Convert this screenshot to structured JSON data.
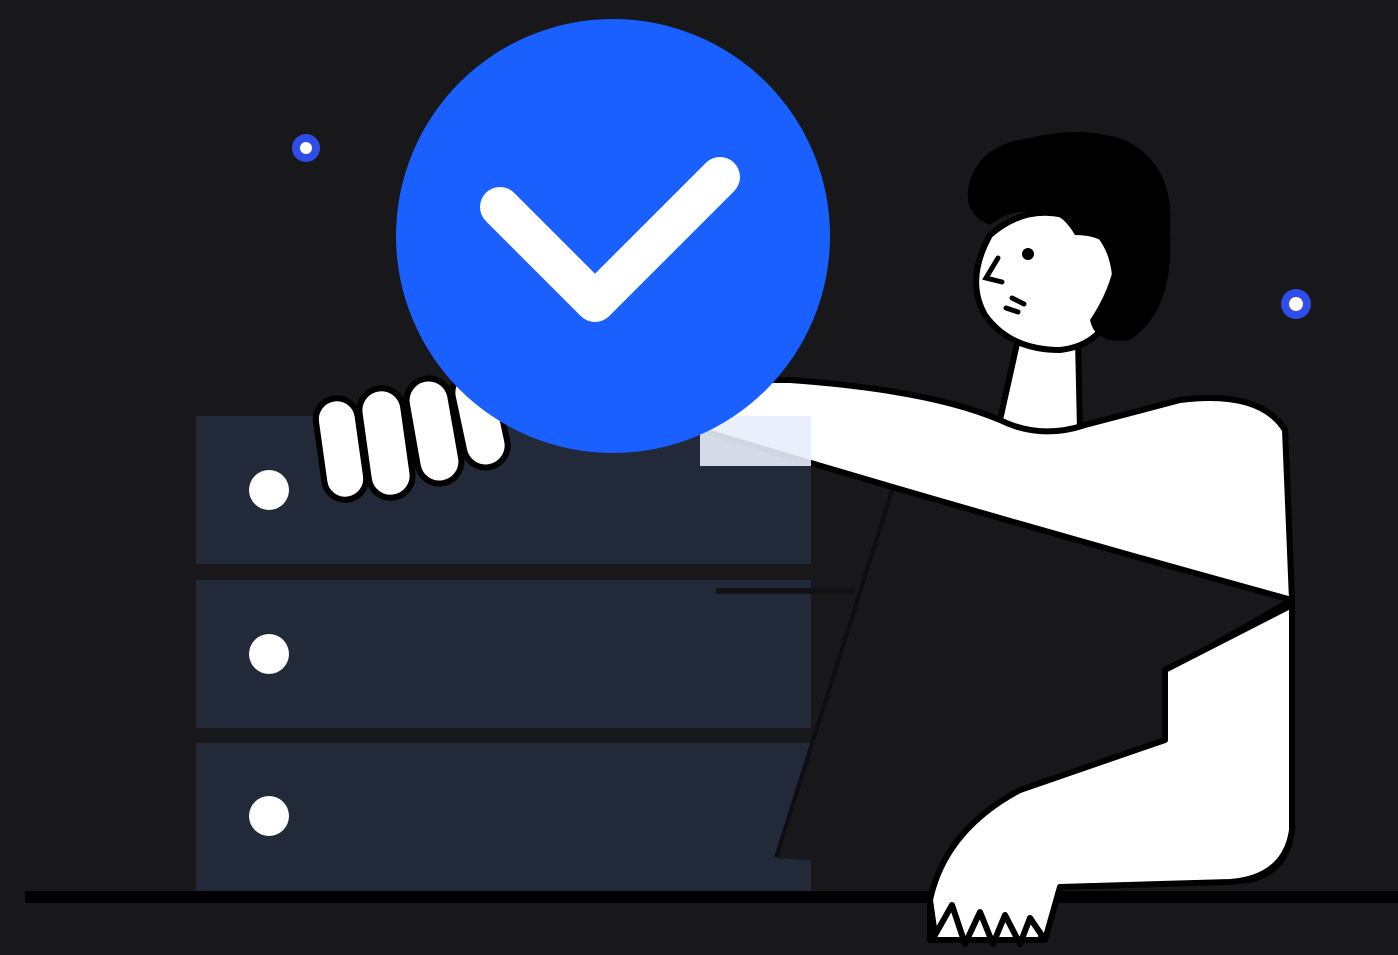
{
  "scene": {
    "description_free": true,
    "background_color": "#18181b",
    "accent_color": "#1a5fff",
    "server_color": "#222938",
    "ink_color": "#000000",
    "paper_color": "#ffffff",
    "server_rack": {
      "unit_count": 3,
      "icon": "server-rack-icon"
    },
    "success_badge": {
      "icon": "check-icon"
    },
    "sparkles": [
      {
        "icon": "sparkle-dot-icon"
      },
      {
        "icon": "sparkle-dot-icon"
      }
    ],
    "character": {
      "icon": "person-illustration"
    }
  }
}
